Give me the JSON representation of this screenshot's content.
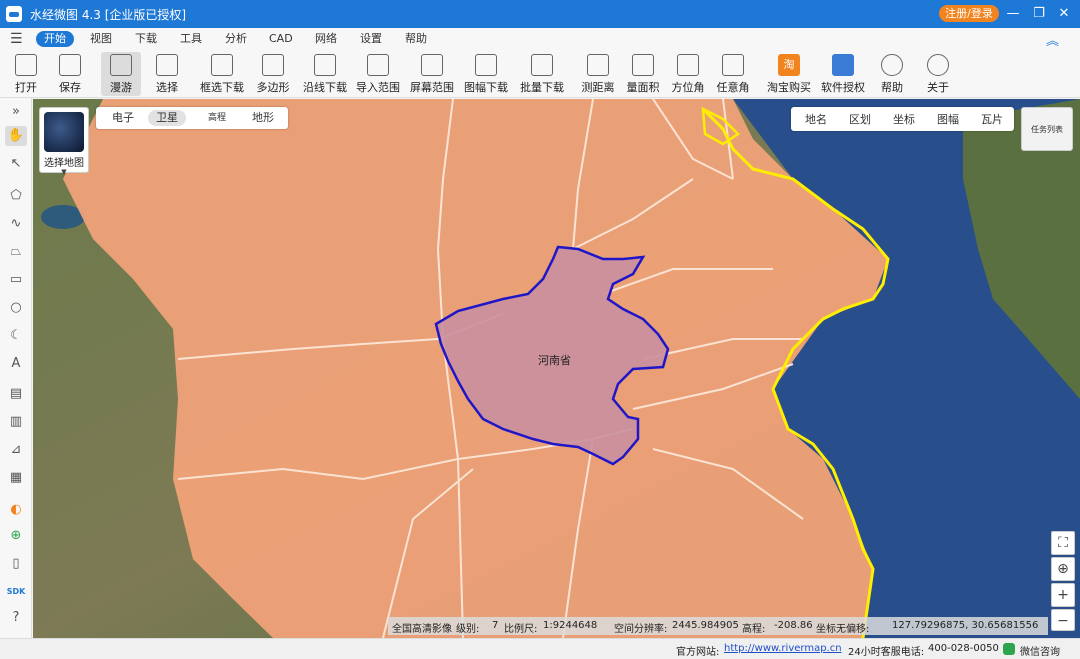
{
  "window": {
    "title": "水经微图 4.3 [企业版已授权]",
    "login_label": "注册/登录",
    "minimize": "—",
    "restore": "❐",
    "close": "✕"
  },
  "menu": {
    "hamburger": "☰",
    "items": [
      "开始",
      "视图",
      "下载",
      "工具",
      "分析",
      "CAD",
      "网络",
      "设置",
      "帮助"
    ],
    "collapse": "︽"
  },
  "toolbar": {
    "items": [
      "打开",
      "保存",
      "漫游",
      "选择",
      "框选下载",
      "多边形",
      "沿线下载",
      "导入范围",
      "屏幕范围",
      "图幅下载",
      "批量下载",
      "测距离",
      "量面积",
      "方位角",
      "任意角",
      "淘宝购买",
      "软件授权",
      "帮助",
      "关于"
    ],
    "taobao_glyph": "淘"
  },
  "sidebar": {
    "expand": "»",
    "icons": [
      "✋",
      "↖",
      "⬠",
      "∿",
      "⏢",
      "▭",
      "○",
      "☾",
      "A",
      "▤",
      "▥",
      "⊿",
      "▦",
      "◐",
      "⊕",
      "▯",
      "SDK",
      "?"
    ]
  },
  "map": {
    "thumb_label": "选择地图",
    "thumb_caret": "▼",
    "map_types": [
      "电子",
      "卫星",
      "高程",
      "地形"
    ],
    "layers": [
      "地名",
      "区划",
      "坐标",
      "图幅",
      "瓦片"
    ],
    "tasklist": "任务列表",
    "province_label": "河南省",
    "zoom": {
      "fullscreen": "⛶",
      "locate": "⊕",
      "zoom_in": "+",
      "zoom_out": "−"
    },
    "colors": {
      "highlight_fill": "#f4a37a",
      "province_fill": "#c98fa0",
      "province_border": "#1f16c8",
      "coast": "#ffee00",
      "sea": "#284f8c"
    }
  },
  "statusbar": {
    "source": "全国高清影像",
    "level_label": "级别:",
    "level": "7",
    "scale_label": "比例尺:",
    "scale": "1:9244648",
    "resolution_label": "空间分辨率:",
    "resolution": "2445.984905",
    "elevation_label": "高程:",
    "elevation": "-208.86",
    "coord_label": "坐标无偏移:",
    "coord": "127.79296875, 30.65681556"
  },
  "footer": {
    "site_label": "官方网站:",
    "site": "http://www.rivermap.cn",
    "phone_label": "24小时客服电话:",
    "phone": "400-028-0050",
    "wechat": "微信咨询"
  }
}
